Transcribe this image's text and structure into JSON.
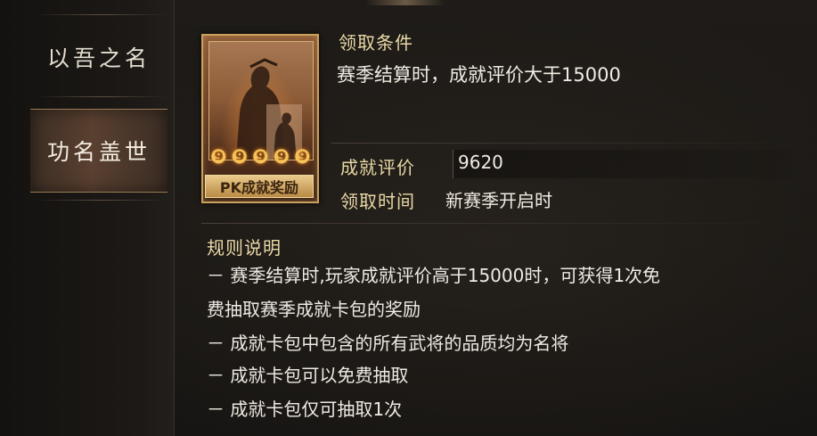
{
  "sidebar": {
    "items": [
      {
        "label": "以吾之名"
      },
      {
        "label": "功名盖世"
      }
    ]
  },
  "reward_card": {
    "label": "PK成就奖励",
    "flame_glyph": "❾"
  },
  "claim": {
    "condition_title": "领取条件",
    "condition_text": "赛季结算时，成就评价大于15000",
    "score_label": "成就评价",
    "score_value": "9620",
    "time_label": "领取时间",
    "time_value": "新赛季开启时"
  },
  "rules": {
    "title": "规则说明",
    "lines": [
      "－ 赛季结算时,玩家成就评价高于15000时，可获得1次免",
      "费抽取赛季成就卡包的奖励",
      "－ 成就卡包中包含的所有武将的品质均为名将",
      "－ 成就卡包可以免费抽取",
      "－ 成就卡包仅可抽取1次"
    ]
  },
  "colors": {
    "accent_gold": "#e9d8a6",
    "card_border": "#c9a15b",
    "selected_tab": "#5a4030"
  }
}
